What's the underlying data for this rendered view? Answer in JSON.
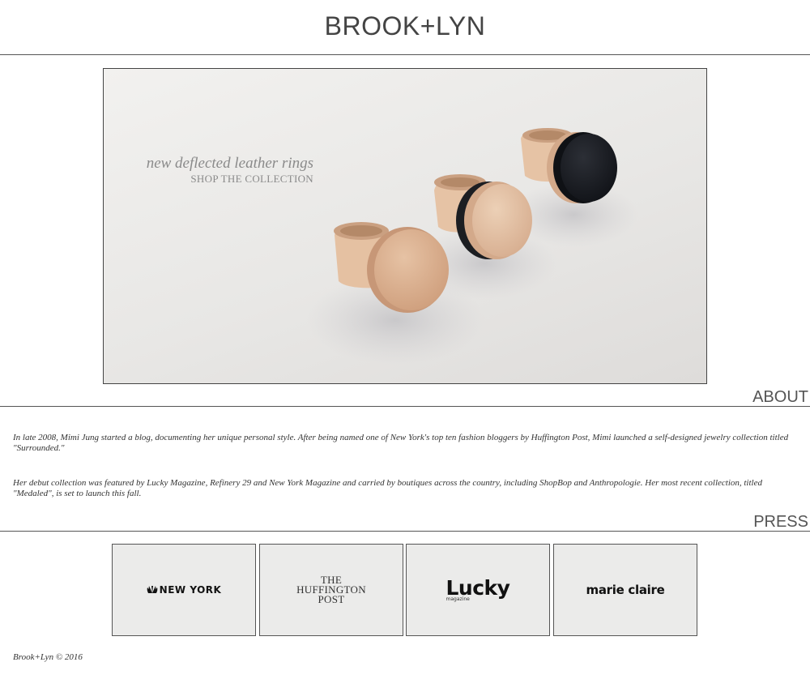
{
  "header": {
    "brand": "BROOK+LYN"
  },
  "hero": {
    "title": "new deflected leather rings",
    "link": "SHOP THE COLLECTION"
  },
  "about": {
    "heading": "ABOUT",
    "paragraphs": [
      "In late 2008, Mimi Jung started a blog, documenting her unique personal style. After being named one of New York's top ten fashion bloggers by Huffington Post, Mimi launched a self-designed jewelry collection titled \"Surrounded.\"",
      "Her debut collection was featured by Lucky Magazine, Refinery 29 and New York Magazine and carried by boutiques across the country, including ShopBop and Anthropologie. Her most recent collection, titled \"Medaled\", is set to launch this fall."
    ]
  },
  "press": {
    "heading": "PRESS",
    "logos": [
      {
        "name": "nbc-new-york",
        "text": "NEW YORK"
      },
      {
        "name": "huffington-post",
        "lines": [
          "THE",
          "HUFFINGTON",
          "POST"
        ]
      },
      {
        "name": "lucky",
        "text": "Lucky",
        "sub": "magazine"
      },
      {
        "name": "marie-claire",
        "text": "marie claire"
      }
    ]
  },
  "footer": {
    "text": "Brook+Lyn © 2016"
  }
}
